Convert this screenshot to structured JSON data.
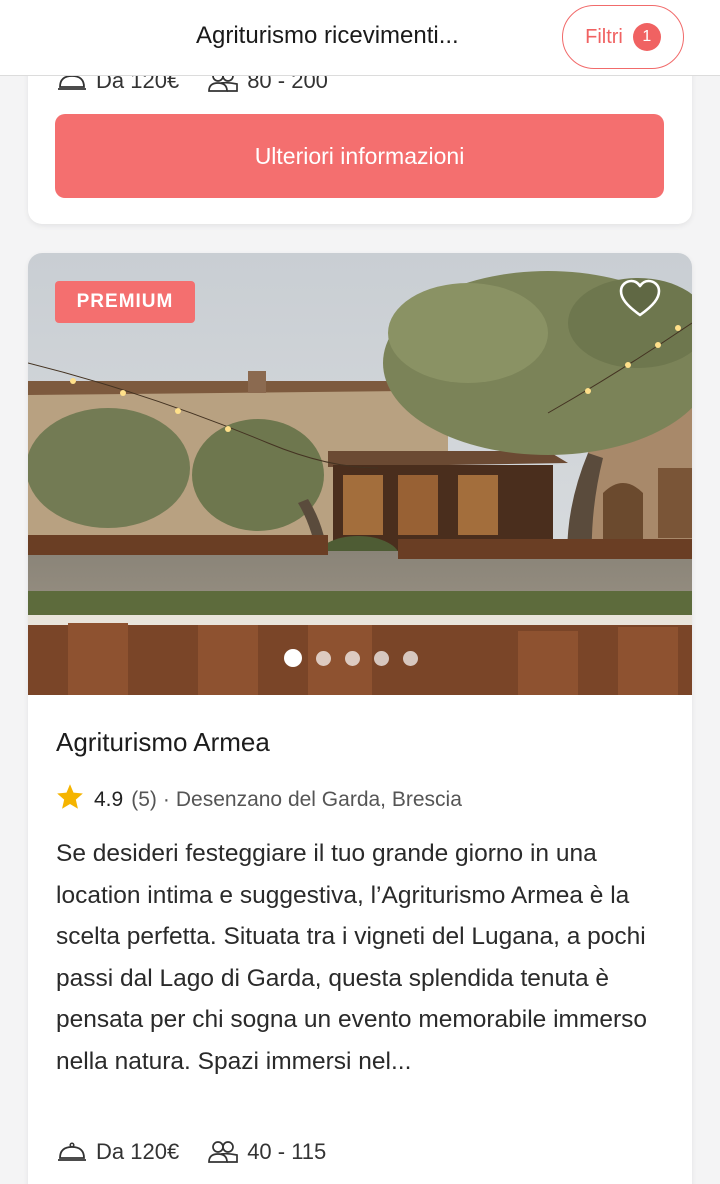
{
  "header": {
    "title": "Agriturismo ricevimenti...",
    "filter_label": "Filtri",
    "filter_count": "1"
  },
  "card_previous": {
    "price": "Da 120€",
    "guests": "80 - 200",
    "button_label": "Ulteriori informazioni"
  },
  "card_main": {
    "badge": "PREMIUM",
    "name": "Agriturismo Armea",
    "rating": "4.9",
    "reviews": "(5)",
    "separator": "·",
    "location": "Desenzano del Garda, Brescia",
    "description": "Se desideri festeggiare il tuo grande giorno in una location intima e suggestiva, l’Agriturismo Armea è la scelta perfetta. Situata tra i vigneti del Lugana, a pochi passi dal Lago di Garda, questa splendida tenuta è pensata per chi sogna un evento memorabile immerso nella natura. Spazi immersi nel...",
    "price": "Da 120€",
    "guests": "40 - 115",
    "photo_count": 5,
    "active_photo": 1
  },
  "colors": {
    "accent": "#f46f6f",
    "star": "#f5b400"
  },
  "icons": [
    "heart-icon",
    "star-icon",
    "cloche-icon",
    "people-icon"
  ]
}
